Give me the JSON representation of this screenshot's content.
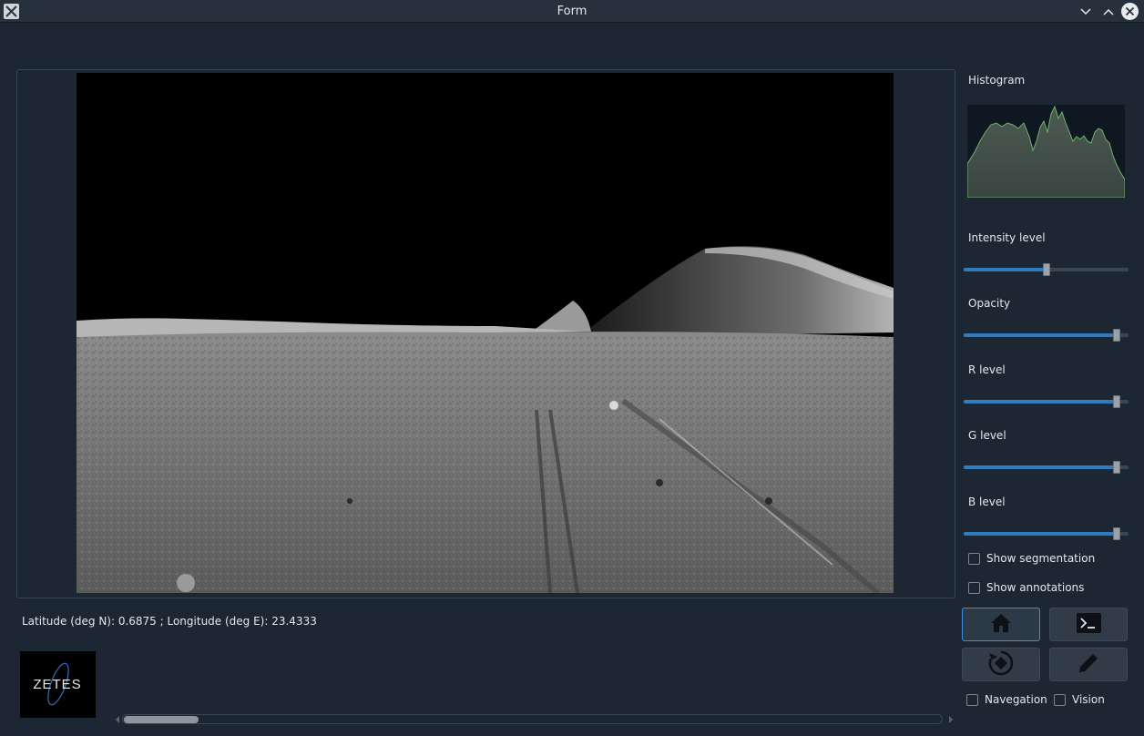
{
  "window": {
    "title": "Form",
    "icon": "x-app-icon",
    "controls": [
      "minimize-icon",
      "maximize-icon",
      "close-icon"
    ]
  },
  "coords_text": "Latitude (deg N): 0.6875 ; Longitude (deg E): 23.4333",
  "logo_text": "ZETES",
  "panel": {
    "histogram_label": "Histogram",
    "sliders": [
      {
        "label": "Intensity level",
        "value": 0.5
      },
      {
        "label": "Opacity",
        "value": 0.95
      },
      {
        "label": "R level",
        "value": 0.95
      },
      {
        "label": "G level",
        "value": 0.95
      },
      {
        "label": "B level",
        "value": 0.95
      }
    ],
    "checkboxes": {
      "segmentation": {
        "label": "Show segmentation",
        "checked": false
      },
      "annotations": {
        "label": "Show annotations",
        "checked": false
      },
      "navegation": {
        "label": "Navegation",
        "checked": false
      },
      "vision": {
        "label": "Vision",
        "checked": false
      }
    },
    "tool_buttons": [
      {
        "icon": "home-icon",
        "active": true
      },
      {
        "icon": "terminal-icon",
        "active": false
      },
      {
        "icon": "rotate-icon",
        "active": false
      },
      {
        "icon": "pencil-icon",
        "active": false
      }
    ]
  },
  "colors": {
    "background": "#1c2733",
    "accent": "#2d7dc0",
    "histogram_line": "#6db36d"
  }
}
